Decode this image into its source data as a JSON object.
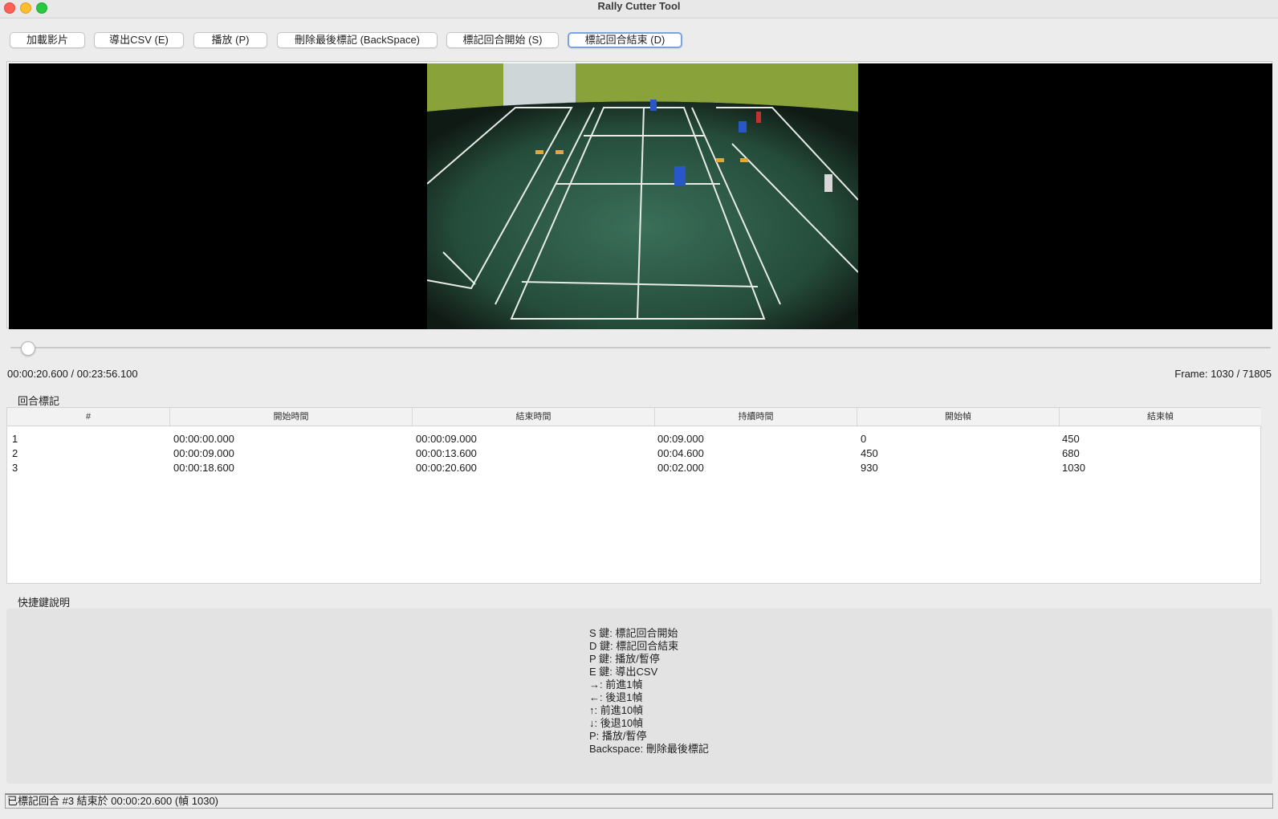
{
  "window": {
    "title": "Rally Cutter Tool"
  },
  "toolbar": {
    "load_video": "加載影片",
    "export_csv": "導出CSV (E)",
    "play": "播放 (P)",
    "delete_last": "刪除最後標記 (BackSpace)",
    "mark_start": "標記回合開始 (S)",
    "mark_end": "標記回合結束 (D)"
  },
  "player": {
    "time_readout": "00:00:20.600 / 00:23:56.100",
    "frame_readout": "Frame: 1030 / 71805",
    "progress_fraction": 0.0143
  },
  "rallies": {
    "title": "回合標記",
    "columns": [
      "#",
      "開始時間",
      "結束時間",
      "持續時間",
      "開始幀",
      "結束幀"
    ],
    "rows": [
      [
        "1",
        "00:00:00.000",
        "00:00:09.000",
        "00:09.000",
        "0",
        "450"
      ],
      [
        "2",
        "00:00:09.000",
        "00:00:13.600",
        "00:04.600",
        "450",
        "680"
      ],
      [
        "3",
        "00:00:18.600",
        "00:00:20.600",
        "00:02.000",
        "930",
        "1030"
      ]
    ]
  },
  "shortcuts": {
    "title": "快捷鍵說明",
    "text": "S 鍵: 標記回合開始\nD 鍵: 標記回合結束\nP 鍵: 播放/暫停\nE 鍵: 導出CSV\n→: 前進1幀\n←: 後退1幀\n↑: 前進10幀\n↓: 後退10幀\nP: 播放/暫停\nBackspace: 刪除最後標記"
  },
  "status": {
    "text": "已標記回合 #3 結束於 00:00:20.600 (幀 1030)"
  }
}
